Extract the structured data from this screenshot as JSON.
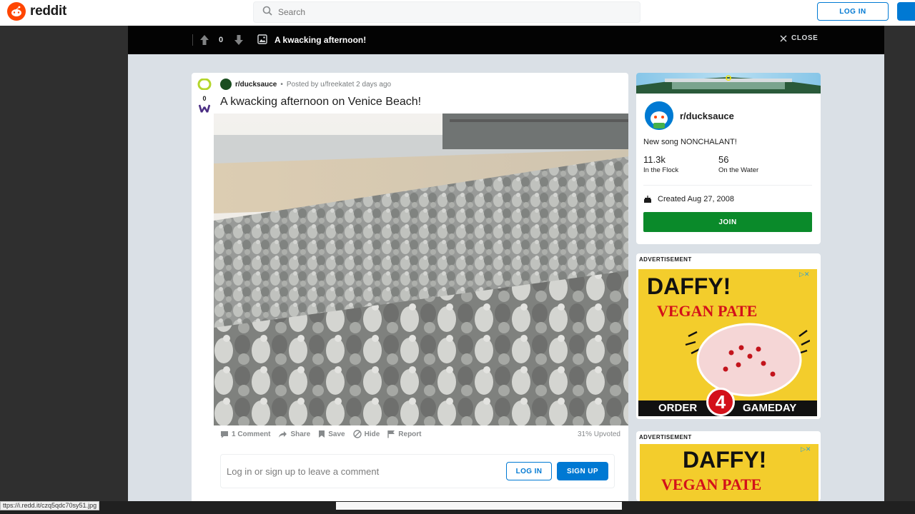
{
  "header": {
    "logo_text": "reddit",
    "search_placeholder": "Search",
    "login_label": "LOG IN"
  },
  "post_bar": {
    "score": "0",
    "title": "A kwacking afternoon!",
    "close_label": "CLOSE"
  },
  "post": {
    "vote_score": "0",
    "subreddit": "r/ducksauce",
    "posted_by": "Posted by u/freekatet 2 days ago",
    "separator": "•",
    "title": "A kwacking afternoon on Venice Beach!",
    "actions": {
      "comments": "1 Comment",
      "share": "Share",
      "save": "Save",
      "hide": "Hide",
      "report": "Report",
      "upvoted": "31% Upvoted"
    },
    "comment_prompt": "Log in or sign up to leave a comment",
    "comment_login": "LOG IN",
    "comment_signup": "SIGN UP"
  },
  "sidebar": {
    "name": "r/ducksauce",
    "description": "New song NONCHALANT!",
    "members_value": "11.3k",
    "members_label": "In the Flock",
    "online_value": "56",
    "online_label": "On the Water",
    "created": "Created Aug 27, 2008",
    "join_label": "JOIN"
  },
  "ads": [
    {
      "label": "ADVERTISEMENT",
      "title": "DAFFY!",
      "subtitle": "VEGAN PATE",
      "footer_left": "ORDER",
      "footer_badge": "4",
      "footer_right": "GAMEDAY",
      "close_glyph": "▷✕"
    },
    {
      "label": "ADVERTISEMENT",
      "title": "DAFFY!",
      "subtitle": "VEGAN PATE",
      "close_glyph": "▷✕"
    }
  ],
  "status": {
    "url": "ttps://i.redd.it/czq5qdc70sy51.jpg"
  },
  "colors": {
    "brand": "#ff4500",
    "accent": "#0079d3",
    "join": "#0a8a2a"
  }
}
